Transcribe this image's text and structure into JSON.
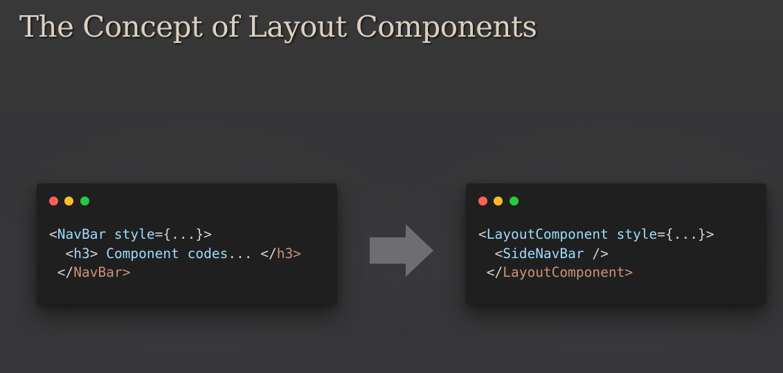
{
  "slide": {
    "title": "The Concept of Layout Components"
  },
  "left_window": {
    "lines": [
      {
        "indent": "",
        "parts": [
          {
            "text": "<",
            "kind": "punct"
          },
          {
            "text": "NavBar style",
            "kind": "name"
          },
          {
            "text": "={...}>",
            "kind": "punct"
          }
        ]
      },
      {
        "indent": "  ",
        "parts": [
          {
            "text": "<",
            "kind": "punct"
          },
          {
            "text": "h3",
            "kind": "name"
          },
          {
            "text": "> ",
            "kind": "punct"
          },
          {
            "text": "Component codes",
            "kind": "name"
          },
          {
            "text": "... ",
            "kind": "punct"
          },
          {
            "text": "</",
            "kind": "punct"
          },
          {
            "text": "h3",
            "kind": "close"
          },
          {
            "text": ">",
            "kind": "close"
          }
        ]
      },
      {
        "indent": " ",
        "parts": [
          {
            "text": "</",
            "kind": "punct"
          },
          {
            "text": "NavBar",
            "kind": "close"
          },
          {
            "text": ">",
            "kind": "close"
          }
        ]
      }
    ]
  },
  "right_window": {
    "lines": [
      {
        "indent": "",
        "parts": [
          {
            "text": "<",
            "kind": "punct"
          },
          {
            "text": "LayoutComponent style",
            "kind": "name"
          },
          {
            "text": "={...}>",
            "kind": "punct"
          }
        ]
      },
      {
        "indent": "  ",
        "parts": [
          {
            "text": "<",
            "kind": "punct"
          },
          {
            "text": "SideNavBar",
            "kind": "name"
          },
          {
            "text": " />",
            "kind": "punct"
          }
        ]
      },
      {
        "indent": " ",
        "parts": [
          {
            "text": "</",
            "kind": "punct"
          },
          {
            "text": "LayoutComponent",
            "kind": "close"
          },
          {
            "text": ">",
            "kind": "close"
          }
        ]
      }
    ]
  },
  "colors": {
    "background": "#38383a",
    "title": "#dcd0bf",
    "window": "#1f1f1f",
    "tag_name": "#9cdcfe",
    "closing_tag": "#ce9178",
    "punctuation": "#d4d4d4",
    "dot_red": "#ff5f56",
    "dot_yellow": "#ffbd2e",
    "dot_green": "#27c93f",
    "arrow": "#6e6e70"
  },
  "icons": {
    "arrow": "right-arrow-icon",
    "window_controls": [
      "close-dot-icon",
      "minimize-dot-icon",
      "maximize-dot-icon"
    ]
  }
}
